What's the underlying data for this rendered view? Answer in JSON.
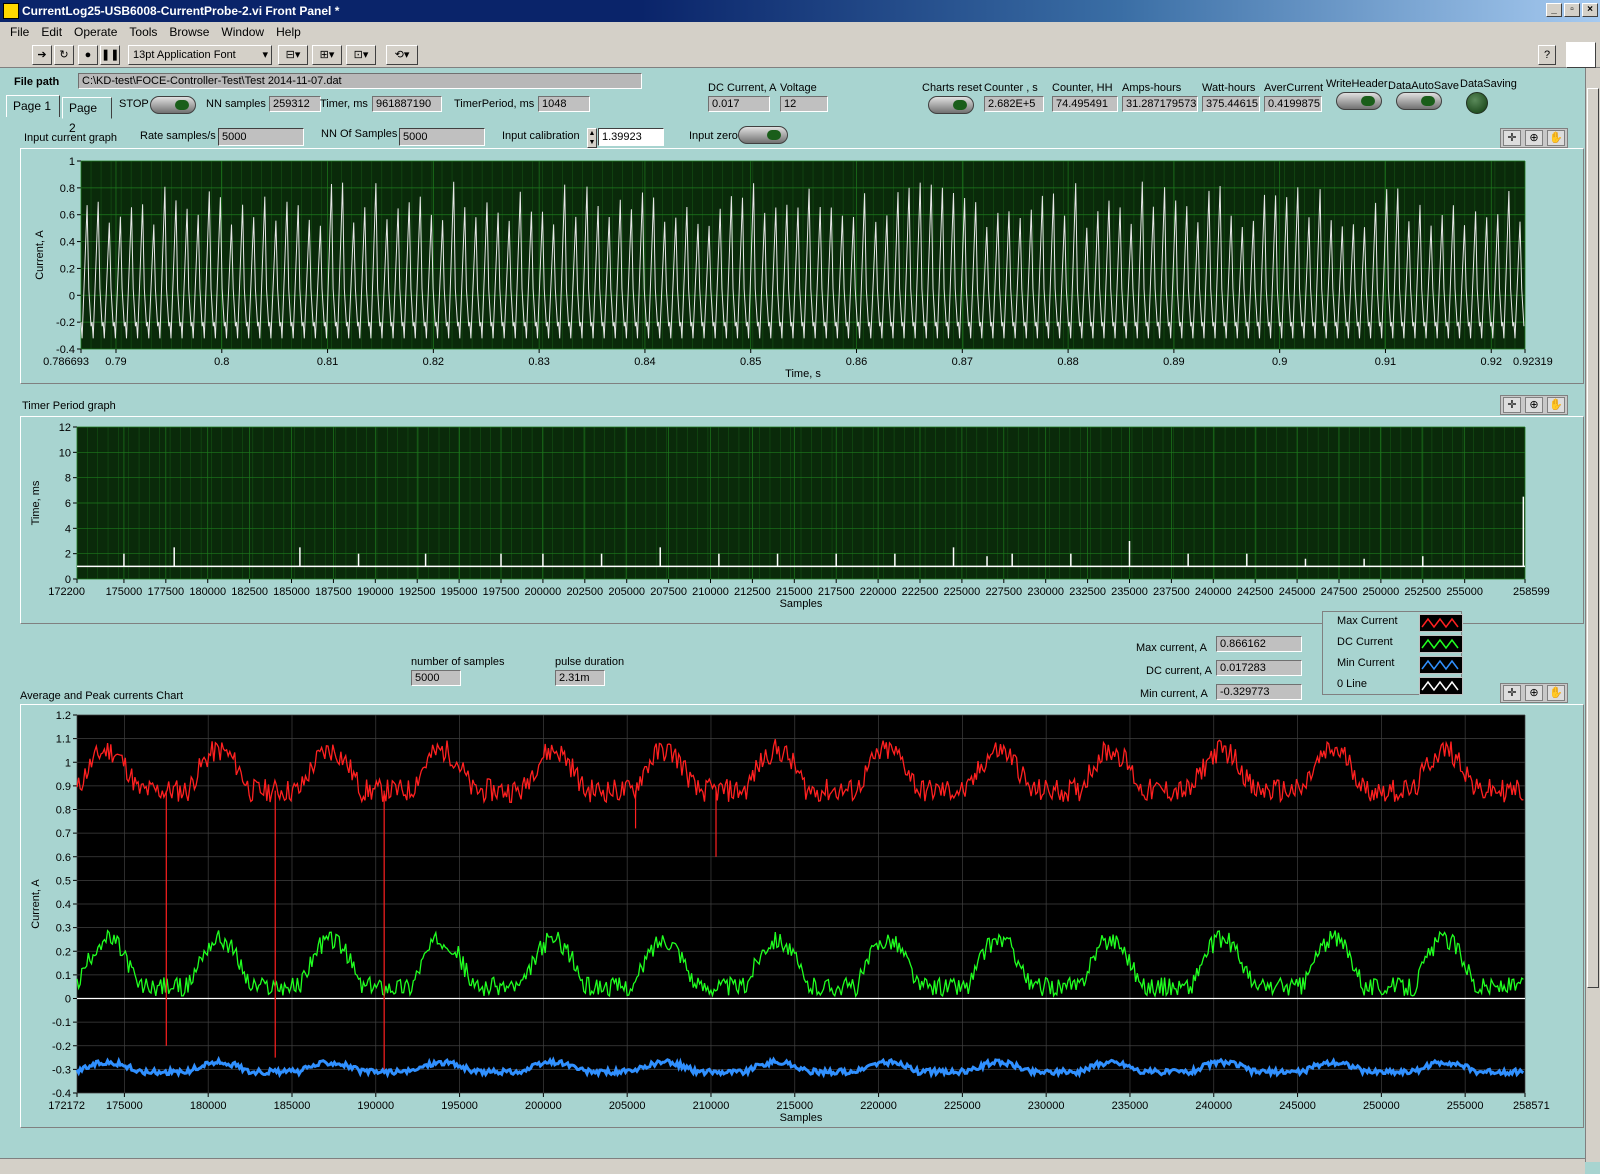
{
  "window": {
    "title": "CurrentLog25-USB6008-CurrentProbe-2.vi Front Panel *"
  },
  "menu": [
    "File",
    "Edit",
    "Operate",
    "Tools",
    "Browse",
    "Window",
    "Help"
  ],
  "toolbar": {
    "font": "13pt Application Font"
  },
  "file_path": {
    "label": "File path",
    "value": "C:\\KD-test\\FOCE-Controller-Test\\Test 2014-11-07.dat"
  },
  "tabs": [
    "Page 1",
    "Page 2"
  ],
  "controls": {
    "stop": "STOP",
    "nn_samples": {
      "label": "NN samples",
      "value": "259312"
    },
    "timer": {
      "label": "Timer, ms",
      "value": "961887190"
    },
    "timer_period": {
      "label": "TimerPeriod, ms",
      "value": "1048"
    },
    "dc_current": {
      "label": "DC Current, A",
      "value": "0.017"
    },
    "voltage": {
      "label": "Voltage",
      "value": "12"
    },
    "charts_reset": "Charts reset",
    "counter_s": {
      "label": "Counter , s",
      "value": "2.682E+5"
    },
    "counter_hh": {
      "label": "Counter, HH",
      "value": "74.495491"
    },
    "amp_hours": {
      "label": "Amps-hours",
      "value": "31.287179573"
    },
    "watt_hours": {
      "label": "Watt-hours",
      "value": "375.44615"
    },
    "aver_current": {
      "label": "AverCurrent",
      "value": "0.4199875"
    },
    "write_header": "WriteHeader",
    "data_autosave": "DataAutoSave",
    "data_saving": "DataSaving"
  },
  "input_graph_controls": {
    "title": "Input current graph",
    "rate": {
      "label": "Rate samples/s",
      "value": "5000"
    },
    "nn_of_samples": {
      "label": "NN Of Samples",
      "value": "5000"
    },
    "calibration": {
      "label": "Input calibration",
      "value": "1.39923"
    },
    "zero": "Input zero"
  },
  "timer_graph_title": "Timer Period graph",
  "avg_chart_title": "Average and Peak currents Chart",
  "stats": {
    "number_of_samples": {
      "label": "number of samples",
      "value": "5000"
    },
    "pulse_duration": {
      "label": "pulse duration",
      "value": "2.31m"
    },
    "max_current": {
      "label": "Max current, A",
      "value": "0.866162"
    },
    "dc_current": {
      "label": "DC current, A",
      "value": "0.017283"
    },
    "min_current": {
      "label": "Min current, A",
      "value": "-0.329773"
    }
  },
  "legend": [
    {
      "name": "Max Current",
      "color": "#ff2020"
    },
    {
      "name": "DC Current",
      "color": "#20ff20"
    },
    {
      "name": "Min Current",
      "color": "#3090ff"
    },
    {
      "name": "0 Line",
      "color": "#ffffff"
    }
  ],
  "chart_data": [
    {
      "type": "line",
      "title": "Input current graph",
      "xlabel": "Time, s",
      "ylabel": "Current, A",
      "xlim": [
        0.786693,
        0.92319
      ],
      "ylim": [
        -0.4,
        1
      ],
      "x_ticks": [
        "0.786693",
        "0.79",
        "0.8",
        "0.81",
        "0.82",
        "0.83",
        "0.84",
        "0.85",
        "0.86",
        "0.87",
        "0.88",
        "0.89",
        "0.9",
        "0.91",
        "0.92",
        "0.92319"
      ],
      "y_ticks": [
        "1",
        "0.8",
        "0.6",
        "0.4",
        "0.2",
        "0",
        "-0.2",
        "-0.4"
      ],
      "series": [
        {
          "color": "#e8e8e8",
          "pulses": 130,
          "baseline": -0.25,
          "peak_range": [
            0.5,
            0.85
          ]
        }
      ]
    },
    {
      "type": "line",
      "title": "Timer Period graph",
      "xlabel": "Samples",
      "ylabel": "Time, ms",
      "xlim": [
        172200,
        258599
      ],
      "ylim": [
        0,
        12
      ],
      "x_ticks": [
        "172200",
        "175000",
        "177500",
        "180000",
        "182500",
        "185000",
        "187500",
        "190000",
        "192500",
        "195000",
        "197500",
        "200000",
        "202500",
        "205000",
        "207500",
        "210000",
        "212500",
        "215000",
        "217500",
        "220000",
        "222500",
        "225000",
        "227500",
        "230000",
        "232500",
        "235000",
        "237500",
        "240000",
        "242500",
        "245000",
        "247500",
        "250000",
        "252500",
        "255000",
        "258599"
      ],
      "y_ticks": [
        "12",
        "10",
        "8",
        "6",
        "4",
        "2",
        "0"
      ],
      "series": [
        {
          "color": "#ffffff",
          "baseline": 1,
          "spikes": [
            [
              175000,
              2
            ],
            [
              178000,
              2.5
            ],
            [
              185500,
              2.5
            ],
            [
              189000,
              2
            ],
            [
              193000,
              2
            ],
            [
              197500,
              2
            ],
            [
              200000,
              2
            ],
            [
              203500,
              2
            ],
            [
              207000,
              2.5
            ],
            [
              210500,
              2
            ],
            [
              214000,
              2
            ],
            [
              217500,
              2
            ],
            [
              221000,
              2
            ],
            [
              224500,
              2.5
            ],
            [
              226500,
              1.8
            ],
            [
              228000,
              2
            ],
            [
              231500,
              2
            ],
            [
              235000,
              3
            ],
            [
              238500,
              2
            ],
            [
              242000,
              2
            ],
            [
              245500,
              1.6
            ],
            [
              249000,
              1.6
            ],
            [
              252500,
              1.8
            ],
            [
              258500,
              6.5
            ]
          ]
        }
      ]
    },
    {
      "type": "line",
      "title": "Average and Peak currents Chart",
      "xlabel": "Samples",
      "ylabel": "Current, A",
      "xlim": [
        172172,
        258571
      ],
      "ylim": [
        -0.4,
        1.2
      ],
      "x_ticks": [
        "172172",
        "175000",
        "180000",
        "185000",
        "190000",
        "195000",
        "200000",
        "205000",
        "210000",
        "215000",
        "220000",
        "225000",
        "230000",
        "235000",
        "240000",
        "245000",
        "250000",
        "255000",
        "258571"
      ],
      "y_ticks": [
        "1.2",
        "1.1",
        "1",
        "0.9",
        "0.8",
        "0.7",
        "0.6",
        "0.5",
        "0.4",
        "0.3",
        "0.2",
        "0.1",
        "0",
        "-0.1",
        "-0.2",
        "-0.3",
        "-0.4"
      ],
      "period": 6650,
      "series": [
        {
          "name": "Max Current",
          "color": "#ff2020",
          "high": 1.05,
          "low": 0.88
        },
        {
          "name": "DC Current",
          "color": "#20ff20",
          "high": 0.25,
          "low": 0.05
        },
        {
          "name": "Min Current",
          "color": "#3090ff",
          "high": -0.27,
          "low": -0.31
        },
        {
          "name": "0 Line",
          "color": "#ffffff",
          "value": 0
        }
      ]
    }
  ]
}
